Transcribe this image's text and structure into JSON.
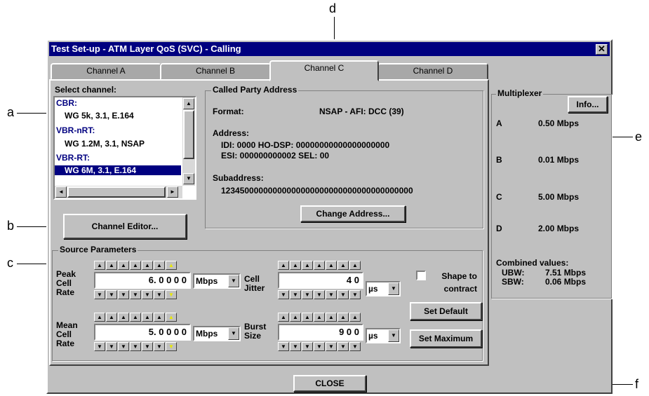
{
  "callouts": {
    "a": "a",
    "b": "b",
    "c": "c",
    "d": "d",
    "e": "e",
    "f": "f"
  },
  "dialog": {
    "title": "Test Set-up - ATM Layer QoS (SVC) - Calling",
    "close_glyph": "✕"
  },
  "tabs": [
    "Channel A",
    "Channel B",
    "Channel C",
    "Channel D"
  ],
  "active_tab": "Channel C",
  "select_channel": {
    "label": "Select channel:",
    "items": [
      {
        "text": "CBR:",
        "type": "header"
      },
      {
        "text": "WG 5k, 3.1, E.164",
        "type": "item"
      },
      {
        "text": "VBR-nRT:",
        "type": "header"
      },
      {
        "text": "WG 1.2M, 3.1, NSAP",
        "type": "item"
      },
      {
        "text": "VBR-RT:",
        "type": "header"
      },
      {
        "text": "WG 6M, 3.1, E.164",
        "type": "selected"
      }
    ]
  },
  "channel_editor_label": "Channel Editor...",
  "called_party": {
    "title": "Called Party Address",
    "format_label": "Format:",
    "format_value": "NSAP - AFI:  DCC (39)",
    "address_label": "Address:",
    "address_line1": "IDI: 0000   HO-DSP: 00000000000000000000",
    "address_line2": "ESI: 000000000002   SEL: 00",
    "subaddress_label": "Subaddress:",
    "subaddress_value": "12345000000000000000000000000000000000000",
    "change_button": "Change Address..."
  },
  "source_params": {
    "title": "Source Parameters",
    "peak_label": "Peak Cell Rate",
    "peak_value": "6. 0 0 0 0",
    "peak_unit": "Mbps",
    "mean_label": "Mean Cell Rate",
    "mean_value": "5. 0 0 0 0",
    "mean_unit": "Mbps",
    "jitter_label": "Cell Jitter",
    "jitter_value": "4 0",
    "jitter_unit": "µs",
    "burst_label": "Burst Size",
    "burst_value": "9 0 0",
    "burst_unit": "µs",
    "shape_label": "Shape to contract",
    "set_default": "Set Default",
    "set_maximum": "Set Maximum"
  },
  "multiplexer": {
    "title": "Multiplexer",
    "info_button": "Info...",
    "channels": [
      {
        "name": "A",
        "value": "0.50 Mbps"
      },
      {
        "name": "B",
        "value": "0.01 Mbps"
      },
      {
        "name": "C",
        "value": "5.00 Mbps"
      },
      {
        "name": "D",
        "value": "2.00 Mbps"
      }
    ],
    "combined_label": "Combined values:",
    "ubw_label": "UBW:",
    "ubw_value": "7.51 Mbps",
    "sbw_label": "SBW:",
    "sbw_value": "0.06 Mbps"
  },
  "close_button": "CLOSE"
}
